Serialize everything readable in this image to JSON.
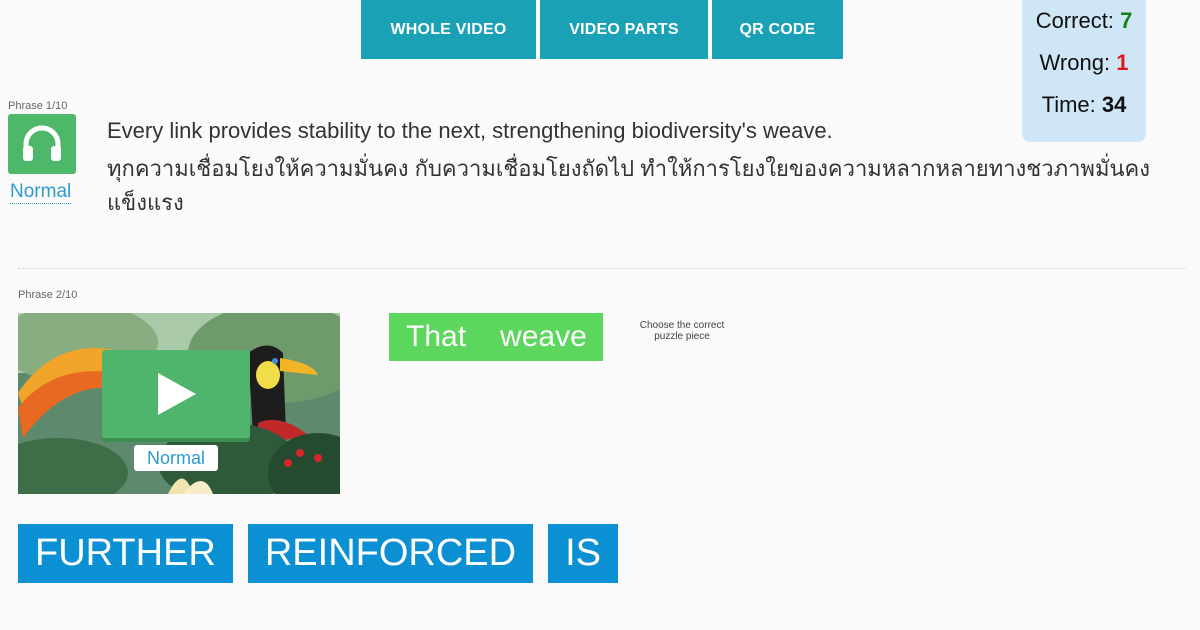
{
  "nav": {
    "buttons": [
      "WHOLE VIDEO",
      "VIDEO PARTS",
      "QR CODE"
    ]
  },
  "score": {
    "correct_label": "Correct:",
    "correct_value": "7",
    "wrong_label": "Wrong:",
    "wrong_value": "1",
    "time_label": "Time:",
    "time_value": "34"
  },
  "phrase1": {
    "label": "Phrase 1/10",
    "icon": "headphones-icon",
    "speed": "Normal",
    "english": "Every link provides stability to the next, strengthening biodiversity's weave.",
    "thai": "ทุกความเชื่อมโยงให้ความมั่นคง กับความเชื่อมโยงถัดไป ทำให้การโยงใยของความหลากหลายทางชวภาพมั่นคงแข็งแรง"
  },
  "phrase2": {
    "label": "Phrase 2/10",
    "video_speed": "Normal",
    "answer_words": [
      "That",
      "weave"
    ],
    "instruction": "Choose the correct puzzle piece",
    "pieces": [
      "FURTHER",
      "REINFORCED",
      "IS"
    ]
  },
  "colors": {
    "nav_button": "#1ba1b6",
    "score_panel": "#cfe6f7",
    "correct": "#16801a",
    "wrong": "#e0161e",
    "audio_button": "#4db86a",
    "answer_box": "#5cd65c",
    "piece": "#0b90d3",
    "link": "#2e9ad0"
  }
}
